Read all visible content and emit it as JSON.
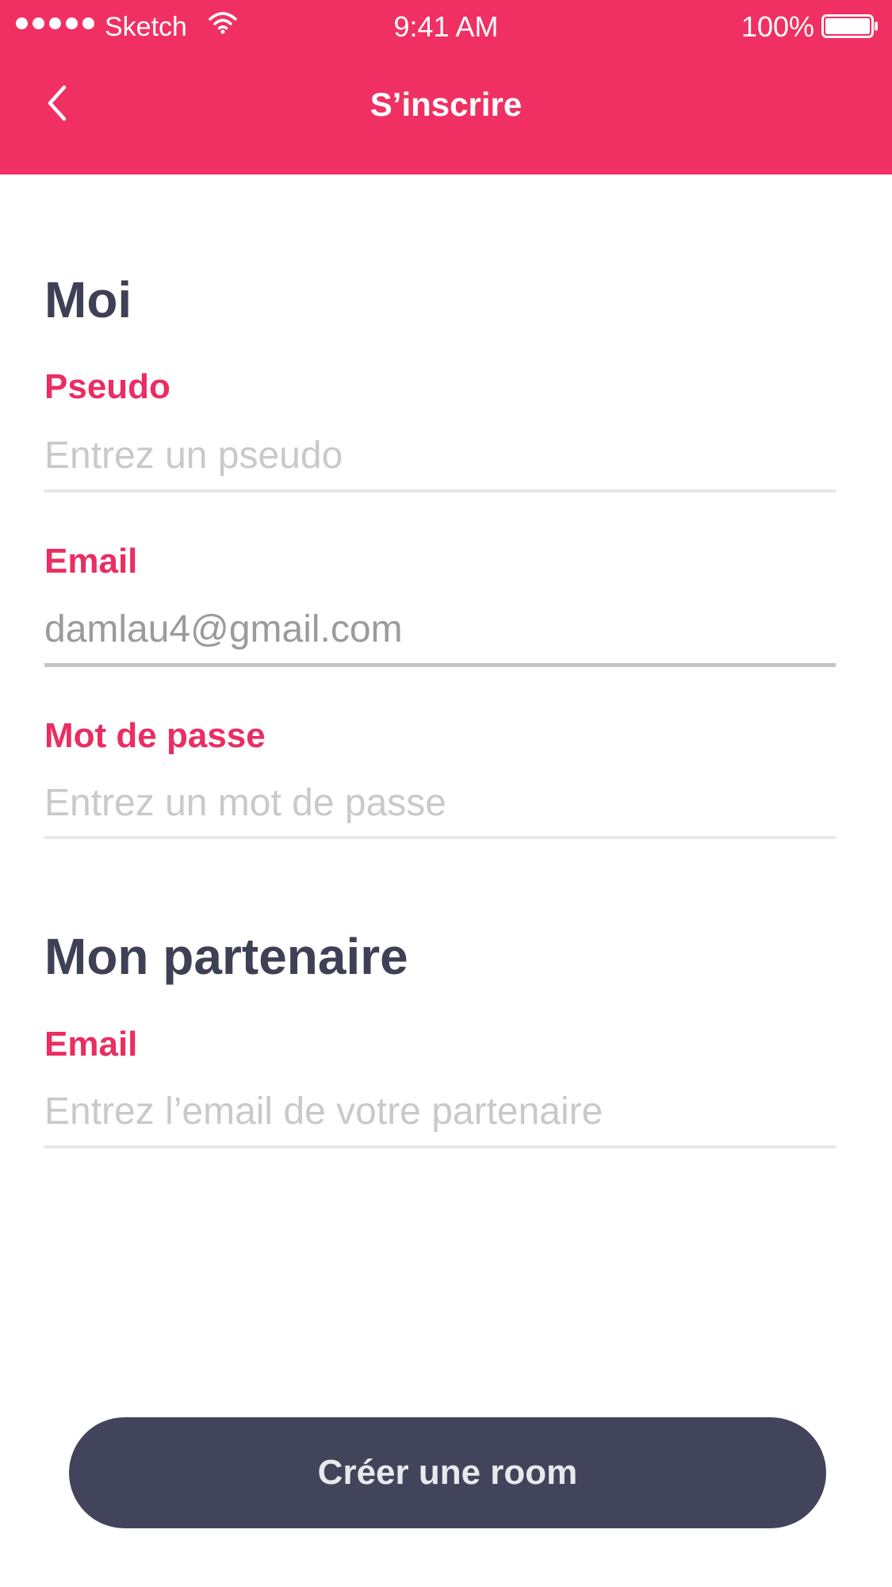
{
  "status_bar": {
    "carrier": "Sketch",
    "time": "9:41 AM",
    "battery_percent": "100%",
    "signal_icon": "signal-dots-icon",
    "wifi_icon": "wifi-icon",
    "battery_icon": "battery-icon"
  },
  "nav": {
    "title": "S’inscrire",
    "back_icon": "chevron-left-icon"
  },
  "sections": {
    "me": {
      "title": "Moi",
      "pseudo": {
        "label": "Pseudo",
        "placeholder": "Entrez un pseudo",
        "value": ""
      },
      "email": {
        "label": "Email",
        "placeholder": "",
        "value": "damlau4@gmail.com"
      },
      "password": {
        "label": "Mot de passe",
        "placeholder": "Entrez un mot de passe",
        "value": ""
      }
    },
    "partner": {
      "title": "Mon partenaire",
      "email": {
        "label": "Email",
        "placeholder": "Entrez l’email de votre partenaire",
        "value": ""
      }
    }
  },
  "cta": {
    "label": "Créer une room"
  },
  "colors": {
    "accent": "#F03062",
    "label": "#EA2D62",
    "heading": "#3E4155",
    "button": "#41445A",
    "placeholder": "#C9C9CC",
    "input_text": "#9A9A9F"
  }
}
